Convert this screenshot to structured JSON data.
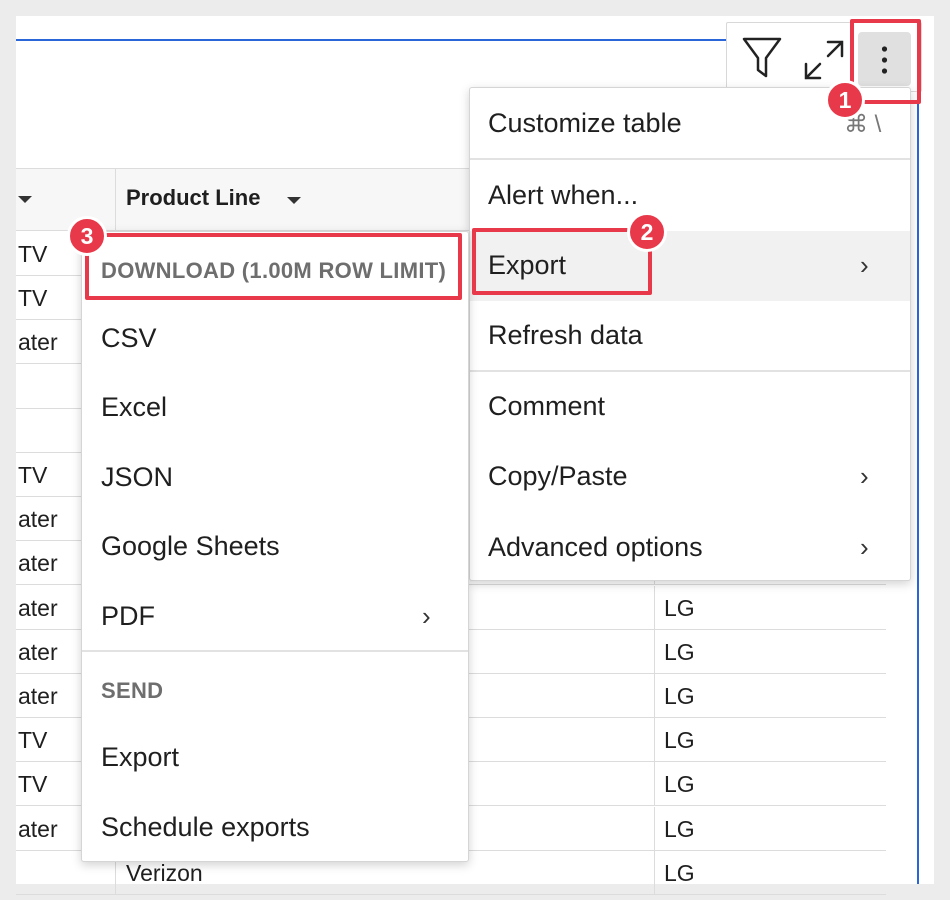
{
  "table": {
    "header": {
      "col2_label": "Product Line"
    },
    "rows": [
      {
        "c1": "TV",
        "c3": ""
      },
      {
        "c1": "TV",
        "c3": ""
      },
      {
        "c1": "ater",
        "c3": ""
      },
      {
        "c1": "",
        "c3": ""
      },
      {
        "c1": "",
        "c3": ""
      },
      {
        "c1": "TV",
        "c3": ""
      },
      {
        "c1": "ater",
        "c3": ""
      },
      {
        "c1": "ater",
        "c3": ""
      },
      {
        "c1": "ater",
        "c3": "LG"
      },
      {
        "c1": "ater",
        "c3": "LG"
      },
      {
        "c1": "ater",
        "c3": "LG"
      },
      {
        "c1": "TV",
        "c3": "LG"
      },
      {
        "c1": "TV",
        "c3": "LG"
      },
      {
        "c1": "ater",
        "c3": "LG"
      },
      {
        "c1": "",
        "c2": "Verizon",
        "c3": "LG"
      }
    ]
  },
  "toolbar": {
    "filter_icon": "filter-icon",
    "expand_icon": "expand-icon",
    "more_icon": "more-vertical-icon"
  },
  "main_menu": {
    "customize_table": "Customize table",
    "customize_shortcut": "⌘ \\",
    "alert_when": "Alert when...",
    "export": "Export",
    "refresh_data": "Refresh data",
    "comment": "Comment",
    "copy_paste": "Copy/Paste",
    "advanced_options": "Advanced options"
  },
  "export_menu": {
    "download_header": "DOWNLOAD (1.00M ROW LIMIT)",
    "csv": "CSV",
    "excel": "Excel",
    "json": "JSON",
    "google_sheets": "Google Sheets",
    "pdf": "PDF",
    "send_header": "SEND",
    "export": "Export",
    "schedule_exports": "Schedule exports"
  },
  "annotations": {
    "step1": "1",
    "step2": "2",
    "step3": "3"
  },
  "colors": {
    "accent_blue": "#2b66d9",
    "annotation_red": "#e8394a",
    "hover_gray": "#f1f1f1"
  }
}
